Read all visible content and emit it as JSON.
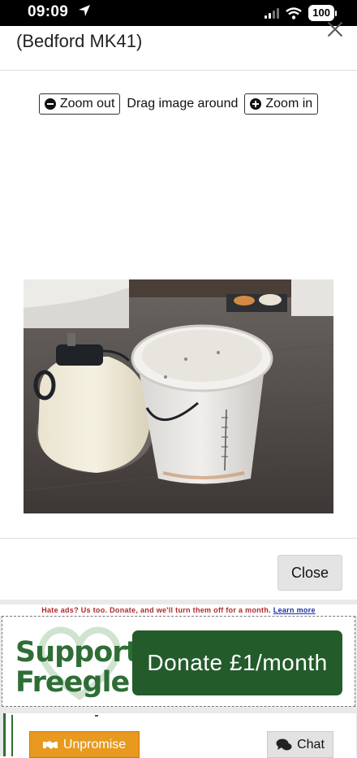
{
  "status_bar": {
    "time": "09:09",
    "battery": "100"
  },
  "modal": {
    "title": "(Bedford MK41)",
    "zoom_out_label": "Zoom out",
    "drag_label": "Drag image around",
    "zoom_in_label": "Zoom in",
    "close_label": "Close"
  },
  "ad": {
    "note": "Hate ads? Us too. Donate, and we'll turn them off for a month.",
    "learn_more": "Learn more",
    "brand_line1": "Support",
    "brand_line2": "Freegle",
    "donate_label": "Donate  £1/month",
    "colors": {
      "brand_green": "#245b2b",
      "text_green": "#2e6e36"
    }
  },
  "actions": {
    "unpromise_label": "Unpromise",
    "chat_label": "Chat",
    "colors": {
      "unpromise": "#e79a1f"
    }
  },
  "icons": [
    "location-arrow-icon",
    "signal-icon",
    "wifi-icon",
    "battery-icon",
    "close-icon",
    "zoom-out-icon",
    "zoom-in-icon",
    "handshake-icon",
    "chat-icon"
  ]
}
